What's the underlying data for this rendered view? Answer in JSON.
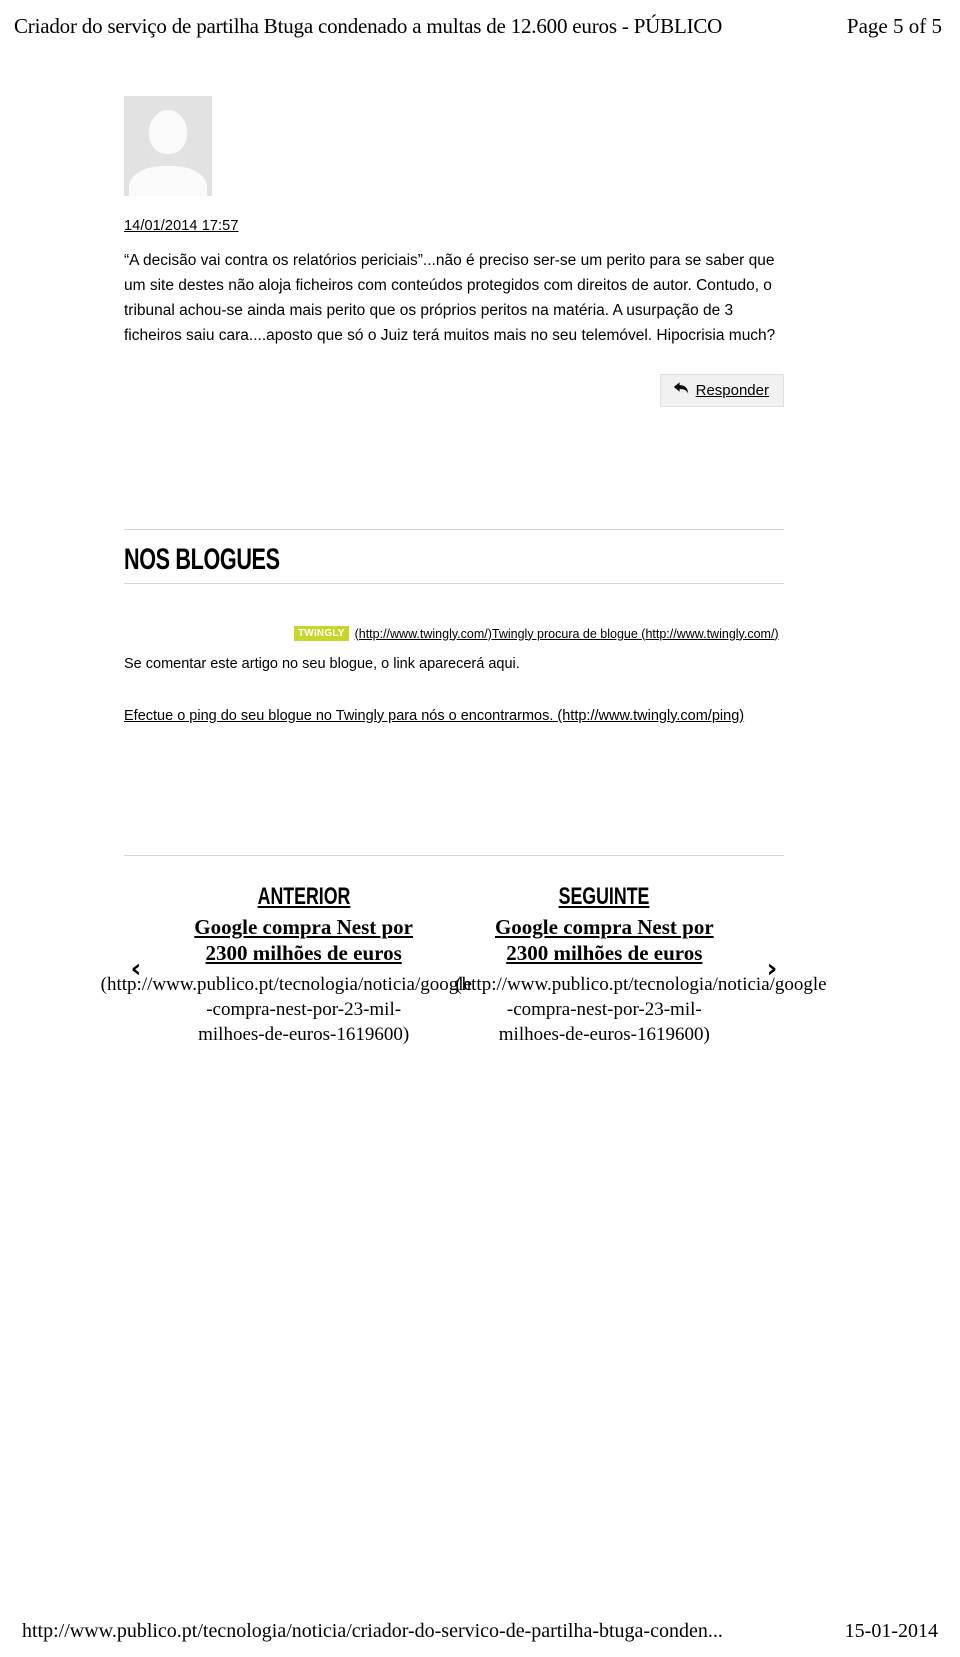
{
  "print_header": {
    "doc_title": "Criador do serviço de partilha Btuga condenado a multas de 12.600 euros - PÚBLICO",
    "page_indicator": "Page 5 of 5"
  },
  "comment": {
    "avatar_alt": "avatar-placeholder",
    "date": "14/01/2014 17:57",
    "text": "“A decisão vai contra os relatórios periciais”...não é preciso ser-se um perito para se saber que um site destes não aloja ficheiros com conteúdos protegidos com direitos de autor. Contudo, o tribunal achou-se ainda mais perito que os próprios peritos na matéria. A usurpação de 3 ficheiros saiu cara....aposto que só o Juiz terá muitos mais no seu telemóvel. Hipocrisia much?",
    "reply_label": "Responder",
    "reply_icon": "reply-arrow-icon"
  },
  "blogues": {
    "heading": "NOS BLOGUES",
    "twingly_logo_text": "TWINGLY",
    "twingly_logo_color": "#c6d62b",
    "twingly_link": "(http://www.twingly.com/)Twingly procura de blogue (http://www.twingly.com/)",
    "note": "Se comentar este artigo no seu blogue, o link aparecerá aqui.",
    "ping_link": "Efectue o ping do seu blogue no Twingly para nós o encontrarmos. (http://www.twingly.com/ping)"
  },
  "navigation": {
    "prev_chevron": "‹",
    "next_chevron": "›",
    "previous": {
      "kicker": "ANTERIOR",
      "title_line1": "Google compra Nest por",
      "title_line2": "2300 milhões de euros",
      "url_line1": "(http://www.publico.pt/tecnologia/noticia/google",
      "url_line2": "-compra-nest-por-23-mil-",
      "url_line3": "milhoes-de-euros-1619600)"
    },
    "next": {
      "kicker": "SEGUINTE",
      "title_line1": "Google compra Nest por",
      "title_line2": "2300 milhões de euros",
      "url_line1": "(http://www.publico.pt/tecnologia/noticia/google",
      "url_line2": "-compra-nest-por-23-mil-",
      "url_line3": "milhoes-de-euros-1619600)"
    }
  },
  "print_footer": {
    "url": "http://www.publico.pt/tecnologia/noticia/criador-do-servico-de-partilha-btuga-conden...",
    "date": "15-01-2014"
  }
}
